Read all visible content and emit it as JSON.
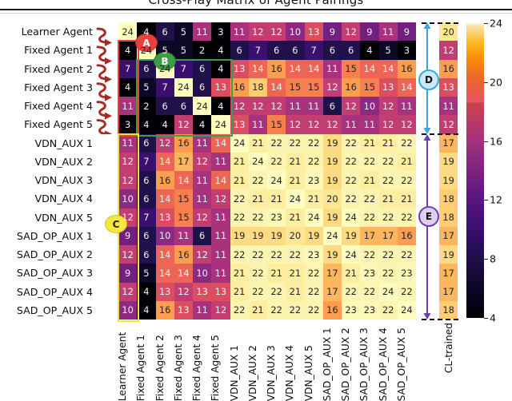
{
  "figure": {
    "title": "Cross-Play Matrix of Agent Pairings",
    "cl_trained_label": "CL-trained"
  },
  "chart_data": {
    "type": "heatmap",
    "title": "Cross-Play Matrix of Agent Pairings",
    "xlabel": "",
    "ylabel": "",
    "colormap": "magma",
    "colorbar": {
      "ticks": [
        4,
        8,
        12,
        16,
        20,
        24
      ],
      "vmin": 4,
      "vmax": 24,
      "position": "right"
    },
    "row_labels": [
      "Learner Agent",
      "Fixed Agent 1",
      "Fixed Agent 2",
      "Fixed Agent 3",
      "Fixed Agent 4",
      "Fixed Agent 5",
      "VDN_AUX 1",
      "VDN_AUX 2",
      "VDN_AUX 3",
      "VDN_AUX 4",
      "VDN_AUX 5",
      "SAD_OP_AUX 1",
      "SAD_OP_AUX 2",
      "SAD_OP_AUX 3",
      "SAD_OP_AUX 4",
      "SAD_OP_AUX 5"
    ],
    "col_labels": [
      "Learner Agent",
      "Fixed Agent 1",
      "Fixed Agent 2",
      "Fixed Agent 3",
      "Fixed Agent 4",
      "Fixed Agent 5",
      "VDN_AUX 1",
      "VDN_AUX 2",
      "VDN_AUX 3",
      "VDN_AUX 4",
      "VDN_AUX 5",
      "SAD_OP_AUX 1",
      "SAD_OP_AUX 2",
      "SAD_OP_AUX 3",
      "SAD_OP_AUX 4",
      "SAD_OP_AUX 5"
    ],
    "values": [
      [
        24,
        4,
        6,
        5,
        11,
        3,
        11,
        12,
        12,
        10,
        13,
        9,
        12,
        9,
        11,
        9
      ],
      [
        4,
        24,
        5,
        5,
        2,
        4,
        6,
        7,
        6,
        6,
        7,
        6,
        6,
        4,
        5,
        3
      ],
      [
        7,
        6,
        24,
        7,
        6,
        4,
        13,
        14,
        16,
        14,
        14,
        11,
        15,
        14,
        14,
        16
      ],
      [
        4,
        5,
        7,
        24,
        6,
        13,
        16,
        18,
        14,
        15,
        15,
        12,
        16,
        15,
        13,
        14
      ],
      [
        11,
        2,
        6,
        6,
        24,
        4,
        12,
        12,
        12,
        11,
        11,
        6,
        12,
        10,
        12,
        11
      ],
      [
        3,
        4,
        4,
        12,
        4,
        24,
        13,
        11,
        15,
        12,
        12,
        12,
        11,
        11,
        12,
        12
      ],
      [
        11,
        6,
        12,
        16,
        11,
        14,
        24,
        21,
        22,
        22,
        22,
        19,
        22,
        21,
        21,
        22
      ],
      [
        12,
        7,
        14,
        17,
        12,
        11,
        21,
        24,
        22,
        21,
        22,
        19,
        22,
        22,
        22,
        21
      ],
      [
        12,
        6,
        16,
        14,
        11,
        14,
        21,
        22,
        24,
        21,
        23,
        19,
        22,
        21,
        22,
        22
      ],
      [
        10,
        6,
        14,
        15,
        11,
        12,
        22,
        21,
        21,
        24,
        21,
        20,
        22,
        22,
        21,
        21
      ],
      [
        12,
        7,
        13,
        15,
        12,
        11,
        22,
        22,
        23,
        21,
        24,
        19,
        24,
        22,
        22,
        22
      ],
      [
        9,
        6,
        10,
        11,
        6,
        11,
        19,
        19,
        19,
        20,
        19,
        24,
        19,
        17,
        17,
        16
      ],
      [
        12,
        6,
        14,
        16,
        12,
        11,
        22,
        22,
        22,
        22,
        23,
        19,
        24,
        22,
        22,
        22
      ],
      [
        9,
        5,
        14,
        14,
        10,
        11,
        21,
        22,
        21,
        21,
        22,
        17,
        21,
        23,
        22,
        23
      ],
      [
        12,
        4,
        13,
        12,
        13,
        13,
        21,
        22,
        22,
        21,
        22,
        17,
        22,
        22,
        24,
        22
      ],
      [
        10,
        4,
        16,
        13,
        11,
        12,
        22,
        21,
        22,
        22,
        22,
        16,
        23,
        23,
        22,
        24
      ]
    ],
    "cl_trained_column": {
      "label": "CL-trained",
      "values": [
        20,
        12,
        16,
        13,
        11,
        12,
        17,
        19,
        19,
        18,
        18,
        17,
        19,
        17,
        17,
        18
      ]
    },
    "annotations": [
      {
        "id": "A",
        "label": "A",
        "color": "#e8413a",
        "shape": "ellipse",
        "desc": "red ellipse over learner-agent self-play diagonal region"
      },
      {
        "id": "B",
        "label": "B",
        "color": "#3f9b45",
        "shape": "ellipse",
        "desc": "green ellipse over fixed-agent diagonal block"
      },
      {
        "id": "C",
        "label": "C",
        "color": "#f5e73d",
        "shape": "ellipse",
        "desc": "yellow ellipse marking learner-agent column for AUX rows"
      },
      {
        "id": "D",
        "label": "D",
        "color": "#3aa6e0",
        "shape": "circle",
        "desc": "blue bracket spanning the six non-CL-trained rows"
      },
      {
        "id": "E",
        "label": "E",
        "color": "#6a3fb5",
        "shape": "circle",
        "desc": "purple bracket spanning the ten CL-trained AUX rows"
      }
    ],
    "highlight_boxes": [
      {
        "name": "red-box",
        "color": "#e8413a",
        "cols": [
          0,
          0
        ],
        "rows": [
          1,
          5
        ]
      },
      {
        "name": "green-box",
        "color": "#3f9b45",
        "cols": [
          1,
          5
        ],
        "rows": [
          2,
          5
        ]
      },
      {
        "name": "yellow-box",
        "color": "#f2e33a",
        "cols": [
          0,
          0
        ],
        "rows": [
          6,
          15
        ]
      }
    ]
  }
}
